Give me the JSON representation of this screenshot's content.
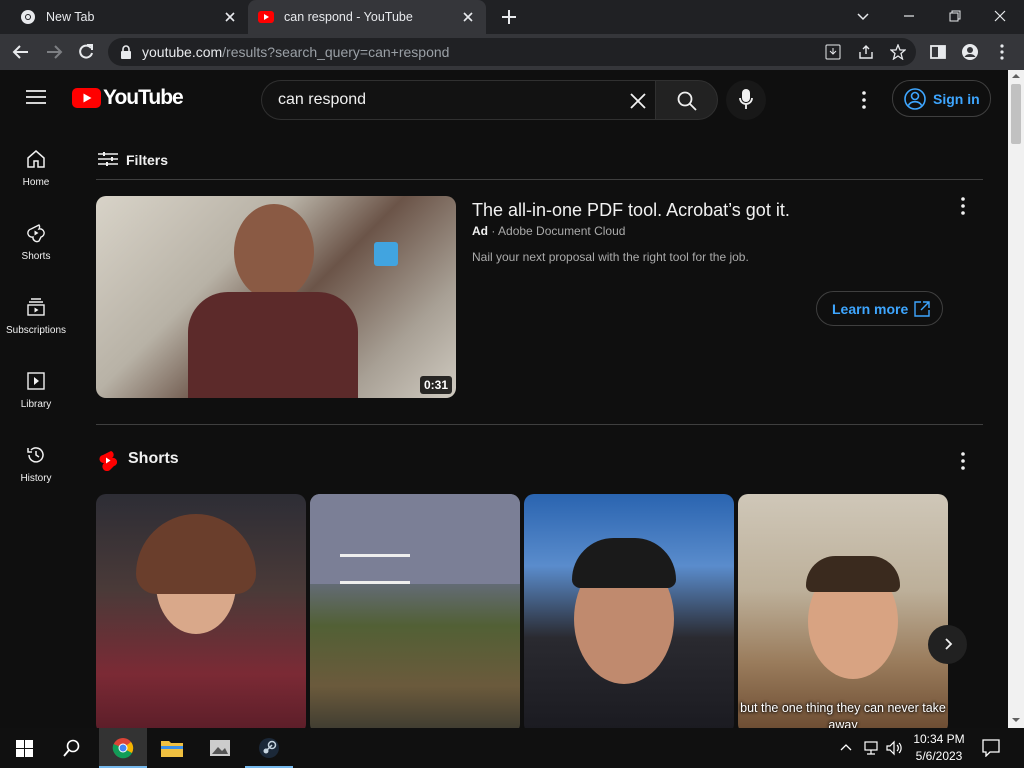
{
  "browser": {
    "tabs": [
      {
        "title": "New Tab"
      },
      {
        "title": "can respond - YouTube"
      }
    ],
    "url_host": "youtube.com",
    "url_path": "/results?search_query=can+respond"
  },
  "youtube": {
    "logo_text": "YouTube",
    "search_value": "can respond",
    "signin_label": "Sign in",
    "nav": [
      {
        "label": "Home",
        "icon": "home-icon"
      },
      {
        "label": "Shorts",
        "icon": "shorts-icon"
      },
      {
        "label": "Subscriptions",
        "icon": "subscriptions-icon"
      },
      {
        "label": "Library",
        "icon": "library-icon"
      },
      {
        "label": "History",
        "icon": "history-icon"
      }
    ],
    "filters_label": "Filters",
    "ad": {
      "title": "The all-in-one PDF tool. Acrobat’s got it.",
      "badge": "Ad",
      "separator": "·",
      "advertiser": "Adobe Document Cloud",
      "description": "Nail your next proposal with the right tool for the job.",
      "duration": "0:31",
      "cta": "Learn more"
    },
    "shorts": {
      "heading": "Shorts",
      "caption": "but the one thing they can never take away"
    }
  },
  "taskbar": {
    "time": "10:34 PM",
    "date": "5/6/2023"
  },
  "colors": {
    "yt_red": "#ff0000",
    "link_blue": "#3ea6ff",
    "page_bg": "#0f0f0f"
  }
}
